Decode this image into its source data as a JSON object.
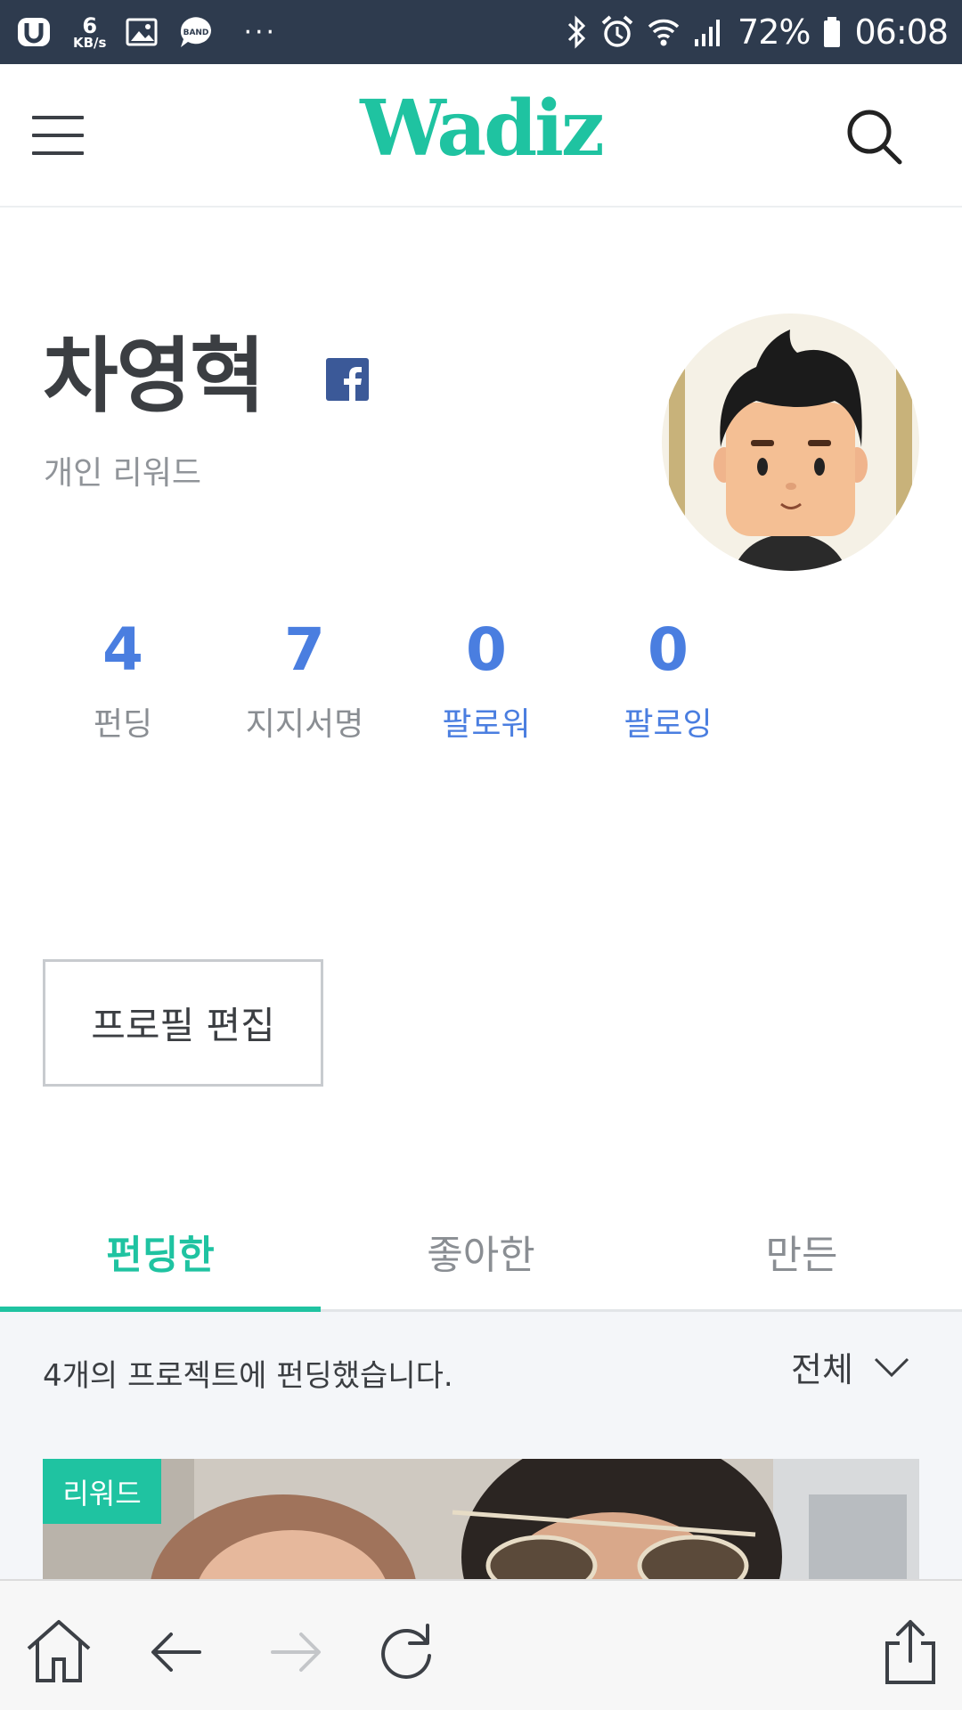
{
  "status_bar": {
    "speed_value": "6",
    "speed_unit": "KB/s",
    "dots": "···",
    "battery": "72%",
    "time": "06:08"
  },
  "header": {
    "logo": "Wadiz"
  },
  "profile": {
    "name": "차영혁",
    "subtitle": "개인 리워드"
  },
  "stats": [
    {
      "value": "4",
      "label": "펀딩"
    },
    {
      "value": "7",
      "label": "지지서명"
    },
    {
      "value": "0",
      "label": "팔로워"
    },
    {
      "value": "0",
      "label": "팔로잉"
    }
  ],
  "edit_button": "프로필 편집",
  "tabs": [
    {
      "label": "펀딩한",
      "active": true
    },
    {
      "label": "좋아한",
      "active": false
    },
    {
      "label": "만든",
      "active": false
    }
  ],
  "content": {
    "summary": "4개의 프로젝트에 펀딩했습니다.",
    "filter": "전체",
    "card_badge": "리워드"
  },
  "colors": {
    "brand": "#1fc3a1",
    "stat_blue": "#4a7ee0",
    "facebook": "#3b5998",
    "status_bar": "#2e3b4e"
  },
  "icons": {
    "menu": "hamburger-icon",
    "search": "search-icon",
    "facebook": "facebook-icon",
    "home": "home-icon",
    "back": "arrow-left-icon",
    "forward": "arrow-right-icon",
    "refresh": "refresh-icon",
    "share": "share-icon"
  }
}
